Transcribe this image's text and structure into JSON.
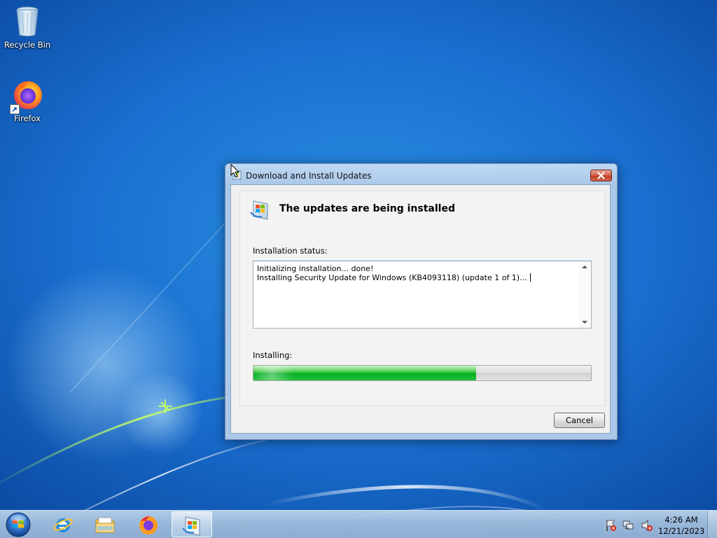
{
  "desktop": {
    "icons": [
      {
        "label": "Recycle Bin",
        "icon": "recycle-bin-icon"
      },
      {
        "label": "Firefox",
        "icon": "firefox-icon"
      }
    ]
  },
  "window": {
    "title": "Download and Install Updates",
    "header_title": "The updates are being installed",
    "status_label": "Installation status:",
    "status_lines": [
      "Initializing installation... done!",
      "Installing Security Update for Windows (KB4093118) (update 1 of 1)..."
    ],
    "progress_label": "Installing:",
    "progress_fraction": 0.66,
    "cancel_label": "Cancel"
  },
  "taskbar": {
    "pinned": [
      "start-orb-icon",
      "internet-explorer-icon",
      "windows-explorer-icon",
      "firefox-icon",
      "windows-update-icon"
    ],
    "tray_icons": [
      "action-center-flag-icon",
      "network-icon",
      "volume-muted-icon"
    ],
    "clock": {
      "time": "4:26 AM",
      "date": "12/21/2023"
    }
  },
  "colors": {
    "desktop_blue": "#1a6fd0",
    "progress_green": "#06b025",
    "close_red": "#c0412b"
  }
}
